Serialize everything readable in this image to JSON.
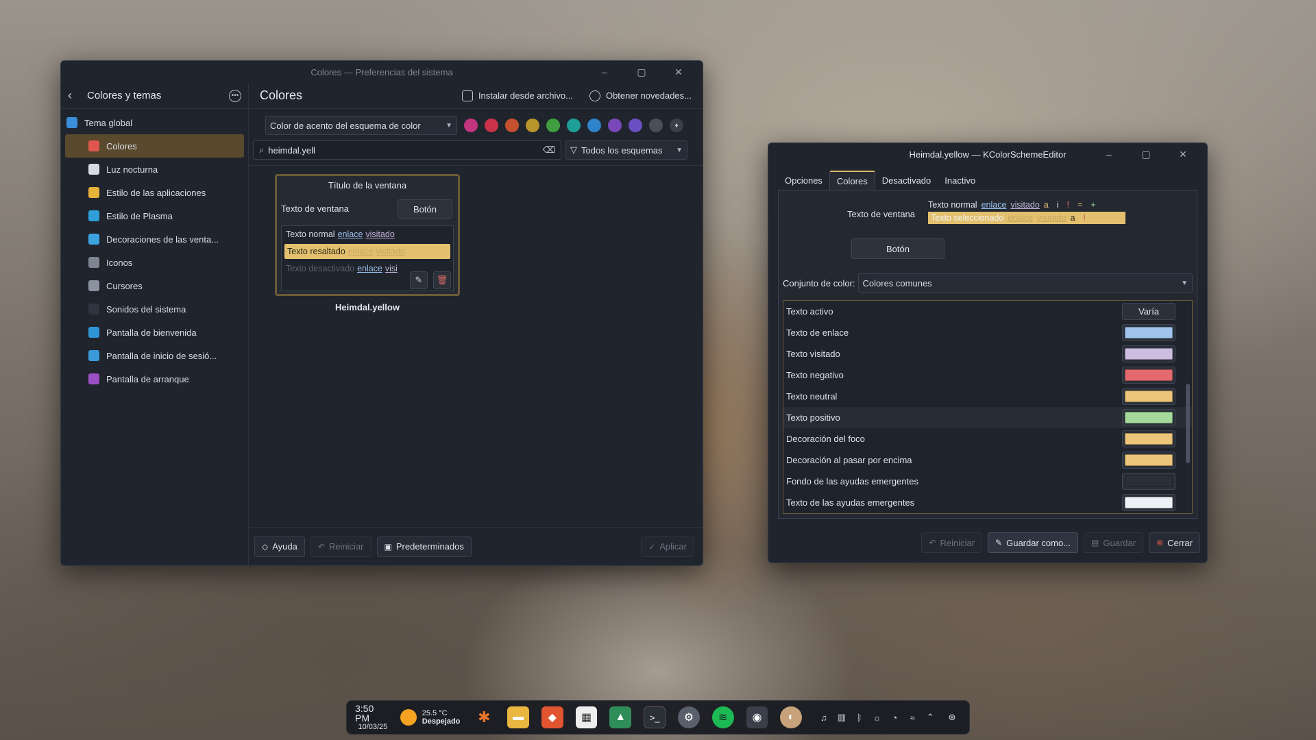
{
  "settings": {
    "window_title": "Colores — Preferencias del sistema",
    "sidebar": {
      "title": "Colores y temas",
      "items": [
        {
          "label": "Tema global",
          "icon": "global-theme-icon",
          "color": "#3b8fd9"
        },
        {
          "label": "Colores",
          "icon": "colors-icon",
          "color": "#e0564f"
        },
        {
          "label": "Luz nocturna",
          "icon": "night-light-icon",
          "color": "#d6dbe4"
        },
        {
          "label": "Estilo de las aplicaciones",
          "icon": "app-style-icon",
          "color": "#e7b23a"
        },
        {
          "label": "Estilo de Plasma",
          "icon": "plasma-style-icon",
          "color": "#2e9fd8"
        },
        {
          "label": "Decoraciones de las venta...",
          "icon": "window-decorations-icon",
          "color": "#3ca3e0"
        },
        {
          "label": "Iconos",
          "icon": "icons-icon",
          "color": "#7d8593"
        },
        {
          "label": "Cursores",
          "icon": "cursors-icon",
          "color": "#8a929f"
        },
        {
          "label": "Sonidos del sistema",
          "icon": "system-sounds-icon",
          "color": "#2f3540"
        },
        {
          "label": "Pantalla de bienvenida",
          "icon": "splash-screen-icon",
          "color": "#2f94d6"
        },
        {
          "label": "Pantalla de inicio de sesió...",
          "icon": "login-screen-icon",
          "color": "#3a9ad9"
        },
        {
          "label": "Pantalla de arranque",
          "icon": "boot-screen-icon",
          "color": "#9b4fc4"
        }
      ]
    },
    "header": {
      "title": "Colores",
      "install_label": "Instalar desde archivo...",
      "get_new_label": "Obtener novedades..."
    },
    "accent_select": "Color de acento del esquema de color",
    "accent_swatches": [
      "#c2367f",
      "#c8334a",
      "#c4502f",
      "#b8942a",
      "#3f9e3f",
      "#1f9e98",
      "#2f83c8",
      "#7a48b8",
      "#6a4fc2",
      "#4a4f58"
    ],
    "search": {
      "value": "heimdal.yell"
    },
    "filter_label": "Todos los esquemas",
    "preview": {
      "title": "Título de la ventana",
      "window_text": "Texto de ventana",
      "button": "Botón",
      "normal": "Texto normal",
      "link": "enlace",
      "visited": "visitado",
      "highlighted": "Texto resaltado",
      "disabled": "Texto desactivado",
      "disabled_visited": "visi"
    },
    "scheme_name": "Heimdal.yellow",
    "footer": {
      "help": "Ayuda",
      "reset": "Reiniciar",
      "defaults": "Predeterminados",
      "apply": "Aplicar"
    }
  },
  "editor": {
    "window_title": "Heimdal.yellow — KColorSchemeEditor",
    "tabs": [
      "Opciones",
      "Colores",
      "Desactivado",
      "Inactivo"
    ],
    "active_tab": "Colores",
    "sample": {
      "window_text": "Texto de ventana",
      "normal": "Texto normal",
      "link": "enlace",
      "visited": "visitado",
      "selected": "Texto seleccionado",
      "symbols": [
        "a",
        "i",
        "!",
        "=",
        "+"
      ],
      "sel_symbols": [
        "a",
        "!"
      ],
      "button": "Botón"
    },
    "color_set": {
      "label": "Conjunto de color:",
      "value": "Colores comunes"
    },
    "rows": [
      {
        "label": "Texto activo",
        "value": "Varía"
      },
      {
        "label": "Texto de enlace",
        "color": "#9fc3ec"
      },
      {
        "label": "Texto visitado",
        "color": "#cdbde0"
      },
      {
        "label": "Texto negativo",
        "color": "#e56a6f"
      },
      {
        "label": "Texto neutral",
        "color": "#ecc47a"
      },
      {
        "label": "Texto positivo",
        "color": "#a4d99b"
      },
      {
        "label": "Decoración del foco",
        "color": "#ecc47a"
      },
      {
        "label": "Decoración al pasar por encima",
        "color": "#ecc47a"
      },
      {
        "label": "Fondo de las ayudas emergentes",
        "color": "#2a2f38"
      },
      {
        "label": "Texto de las ayudas emergentes",
        "color": "#eef1f6"
      }
    ],
    "footer": {
      "reset": "Reiniciar",
      "save_as": "Guardar como...",
      "save": "Guardar",
      "close": "Cerrar"
    }
  },
  "taskbar": {
    "time": "3:50 PM",
    "date": "10/03/25",
    "temperature": "25.5 °C",
    "weather": "Despejado"
  }
}
